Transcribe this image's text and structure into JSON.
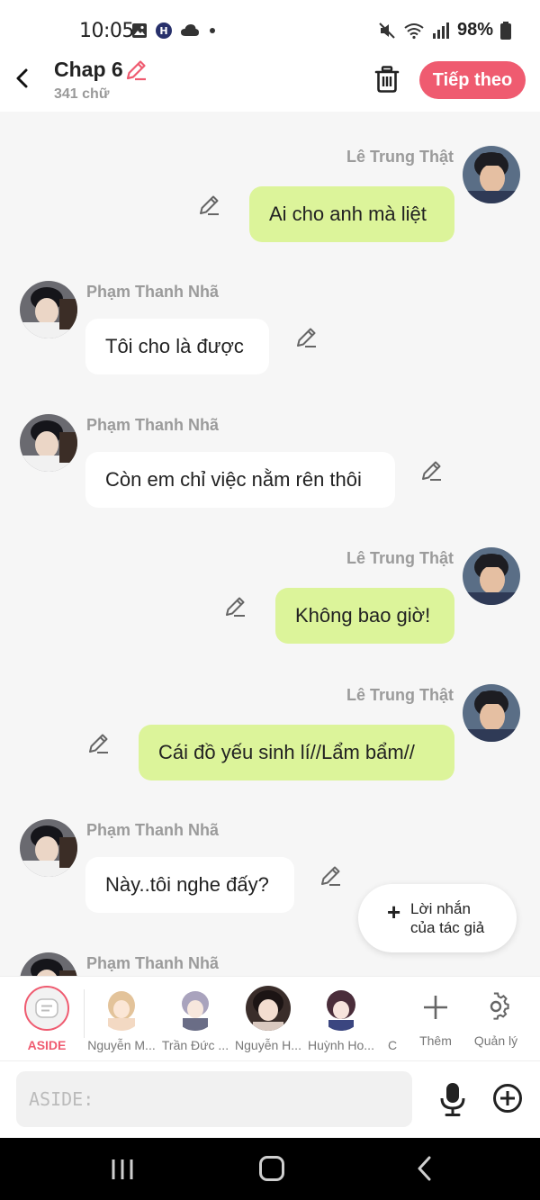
{
  "status_bar": {
    "time": "10:05",
    "battery": "98%"
  },
  "header": {
    "title": "Chap 6",
    "word_count": "341 chữ",
    "next_label": "Tiếp theo"
  },
  "messages": [
    {
      "sender": "Lê Trung Thật",
      "side": "right",
      "text": "Ai cho anh mà liệt"
    },
    {
      "sender": "Phạm Thanh Nhã",
      "side": "left",
      "text": "Tôi cho là được"
    },
    {
      "sender": "Phạm Thanh Nhã",
      "side": "left",
      "text": "Còn em chỉ việc nằm rên thôi"
    },
    {
      "sender": "Lê Trung Thật",
      "side": "right",
      "text": "Không bao giờ!"
    },
    {
      "sender": "Lê Trung Thật",
      "side": "right",
      "text": "Cái đồ yếu sinh lí//Lẩm bẩm//"
    },
    {
      "sender": "Phạm Thanh Nhã",
      "side": "left",
      "text": "Này..tôi nghe đấy?"
    },
    {
      "sender": "Phạm Thanh Nhã",
      "side": "left",
      "text": ""
    }
  ],
  "author_note": {
    "line1": "Lời nhắn",
    "line2": "của tác giả"
  },
  "characters": [
    {
      "label": "ASIDE",
      "selected": true
    },
    {
      "label": "Nguyễn M..."
    },
    {
      "label": "Trần Đức ..."
    },
    {
      "label": "Nguyễn H..."
    },
    {
      "label": "Huỳnh Ho..."
    },
    {
      "label": "C"
    }
  ],
  "tools": {
    "add_label": "Thêm",
    "manage_label": "Quản lý"
  },
  "input": {
    "placeholder": "ASIDE:"
  },
  "colors": {
    "accent": "#ef5b70",
    "my_bubble": "#dcf49a",
    "their_bubble": "#ffffff",
    "background": "#f6f6f6"
  },
  "icons": [
    "back-chevron-icon",
    "pencil-icon",
    "trash-icon",
    "plus-icon",
    "gear-icon",
    "microphone-icon",
    "plus-circle-icon"
  ]
}
